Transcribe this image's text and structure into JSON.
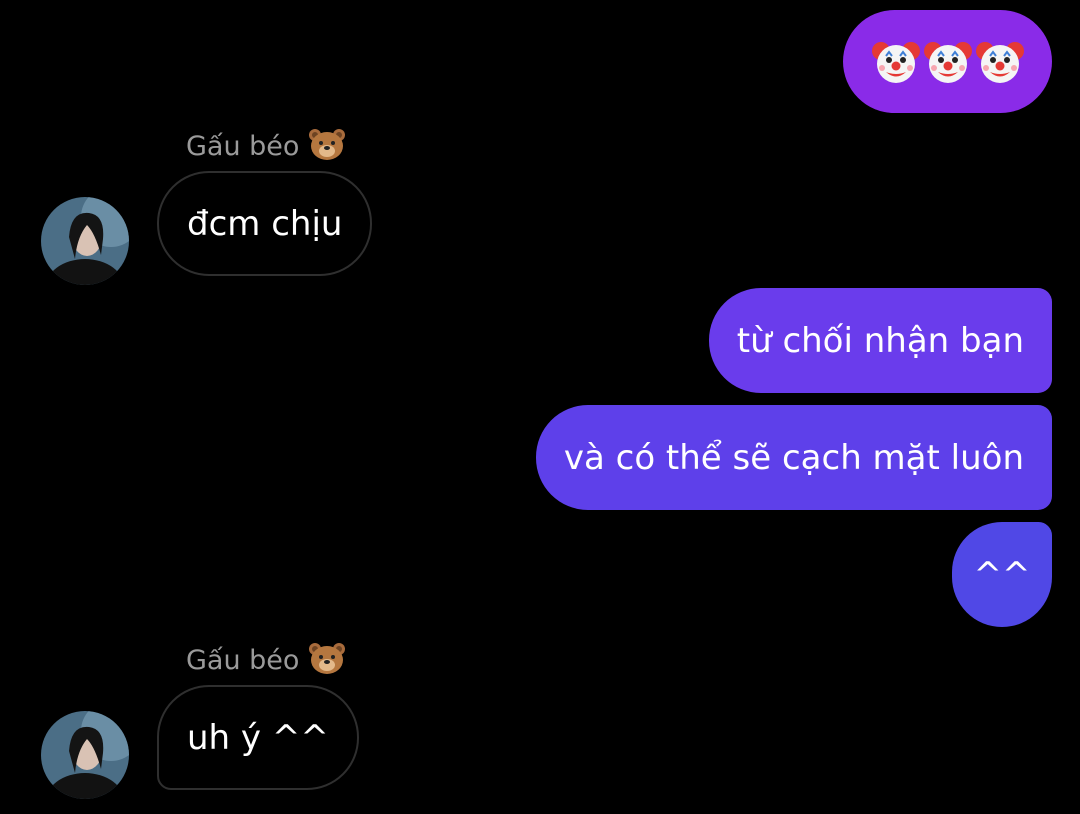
{
  "contact": {
    "name": "Gấu béo",
    "name_emoji": "bear-face-icon"
  },
  "messages": [
    {
      "from": "me",
      "type": "emoji",
      "emojis": [
        "clown-face-icon",
        "clown-face-icon",
        "clown-face-icon"
      ]
    },
    {
      "from": "them",
      "sender": "Gấu béo",
      "text": "đcm chịu"
    },
    {
      "from": "me",
      "text": "từ chối nhận bạn"
    },
    {
      "from": "me",
      "text": "và có thể sẽ cạch mặt luôn"
    },
    {
      "from": "me",
      "text": "^^"
    },
    {
      "from": "them",
      "sender": "Gấu béo",
      "text": "uh ý ^^"
    }
  ],
  "colors": {
    "background": "#000000",
    "outgoing_top": "#8a2be8",
    "outgoing_bottom": "#4e46e5",
    "incoming_border": "#2f2f2f",
    "sender_label": "#9a9a9a"
  }
}
